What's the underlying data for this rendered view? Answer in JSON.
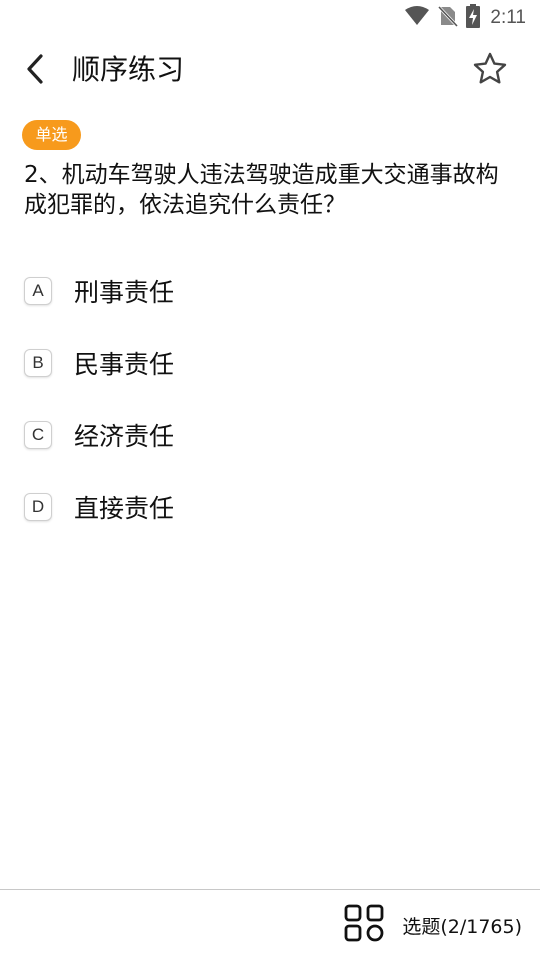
{
  "status_bar": {
    "time": "2:11",
    "icons": [
      "wifi-icon",
      "no-sim-icon",
      "battery-charging-icon"
    ]
  },
  "app_bar": {
    "title": "顺序练习",
    "back_icon": "chevron-left-icon",
    "favorite_icon": "star-outline-icon"
  },
  "question": {
    "type_badge": "单选",
    "text": "2、机动车驾驶人违法驾驶造成重大交通事故构成犯罪的，依法追究什么责任？",
    "options": [
      {
        "letter": "A",
        "text": "刑事责任"
      },
      {
        "letter": "B",
        "text": "民事责任"
      },
      {
        "letter": "C",
        "text": "经济责任"
      },
      {
        "letter": "D",
        "text": "直接责任"
      }
    ]
  },
  "bottom_bar": {
    "picker_icon": "grid-icon",
    "picker_label": "选题(2/1765)"
  },
  "colors": {
    "badge": "#f79a1c",
    "text": "#111111",
    "status": "#555555"
  }
}
